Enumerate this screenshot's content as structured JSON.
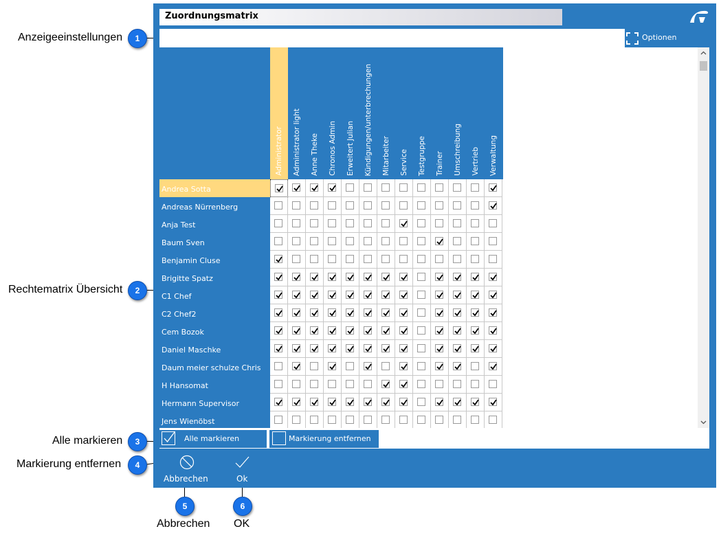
{
  "window": {
    "title": "Zuordnungsmatrix",
    "logo_icon": "app-logo-icon"
  },
  "toolbar": {
    "options_label": "Optionen",
    "options_icon": "expand-icon"
  },
  "annotations": {
    "a1": {
      "number": "1",
      "label": "Anzeigeeinstellungen"
    },
    "a2": {
      "number": "2",
      "label": "Rechtematrix Übersicht"
    },
    "a3": {
      "number": "3",
      "label": "Alle markieren"
    },
    "a4": {
      "number": "4",
      "label": "Markierung entfernen"
    },
    "a5": {
      "number": "5",
      "label": "Abbrechen"
    },
    "a6": {
      "number": "6",
      "label": "OK"
    }
  },
  "matrix": {
    "columns": [
      "Administrator",
      "Administrator light",
      "Anne Theke",
      "Chronos Admin",
      "Erweitert Julian",
      "Kündigungen/unterbrechungen",
      "Mitarbeiter",
      "Service",
      "Testgruppe",
      "Trainer",
      "Umschreibung",
      "Vertrieb",
      "Verwaltung"
    ],
    "highlighted_column": "Administrator",
    "highlighted_row": "Andrea Sotta",
    "rows": [
      {
        "name": "Andrea Sotta",
        "checks": [
          1,
          1,
          1,
          1,
          0,
          0,
          0,
          0,
          0,
          0,
          0,
          0,
          1
        ]
      },
      {
        "name": "Andreas Nürrenberg",
        "checks": [
          0,
          0,
          0,
          0,
          0,
          0,
          0,
          0,
          0,
          0,
          0,
          0,
          1
        ]
      },
      {
        "name": "Anja Test",
        "checks": [
          0,
          0,
          0,
          0,
          0,
          0,
          0,
          1,
          0,
          0,
          0,
          0,
          0
        ]
      },
      {
        "name": "Baum Sven",
        "checks": [
          0,
          0,
          0,
          0,
          0,
          0,
          0,
          0,
          0,
          1,
          0,
          0,
          0
        ]
      },
      {
        "name": "Benjamin Cluse",
        "checks": [
          1,
          0,
          0,
          0,
          0,
          0,
          0,
          0,
          0,
          0,
          0,
          0,
          0
        ]
      },
      {
        "name": "Brigitte Spatz",
        "checks": [
          1,
          1,
          1,
          1,
          1,
          1,
          1,
          1,
          0,
          1,
          1,
          1,
          1
        ]
      },
      {
        "name": "C1 Chef",
        "checks": [
          1,
          1,
          1,
          1,
          1,
          1,
          1,
          1,
          0,
          1,
          1,
          1,
          1
        ]
      },
      {
        "name": "C2 Chef2",
        "checks": [
          1,
          1,
          1,
          1,
          1,
          1,
          1,
          1,
          0,
          1,
          1,
          1,
          1
        ]
      },
      {
        "name": "Cem Bozok",
        "checks": [
          1,
          1,
          1,
          1,
          1,
          1,
          1,
          1,
          0,
          1,
          1,
          1,
          1
        ]
      },
      {
        "name": "Daniel Maschke",
        "checks": [
          1,
          1,
          1,
          1,
          1,
          1,
          1,
          1,
          0,
          1,
          1,
          1,
          1
        ]
      },
      {
        "name": "Daum meier schulze Chris",
        "checks": [
          0,
          1,
          0,
          1,
          0,
          1,
          0,
          1,
          0,
          1,
          1,
          0,
          1
        ]
      },
      {
        "name": "H Hansomat",
        "checks": [
          0,
          0,
          0,
          0,
          0,
          0,
          1,
          1,
          0,
          0,
          0,
          0,
          0
        ]
      },
      {
        "name": "Hermann Supervisor",
        "checks": [
          1,
          1,
          1,
          1,
          1,
          1,
          1,
          1,
          0,
          1,
          1,
          1,
          1
        ]
      },
      {
        "name": "Jens Wienöbst",
        "checks": [
          0,
          0,
          0,
          0,
          0,
          0,
          0,
          0,
          0,
          0,
          0,
          0,
          0
        ]
      }
    ]
  },
  "actions": {
    "select_all_label": "Alle markieren",
    "clear_label": "Markierung entfernen",
    "cancel_label": "Abbrechen",
    "cancel_icon": "cancel-circle-icon",
    "ok_label": "Ok",
    "ok_icon": "checkmark-icon"
  }
}
